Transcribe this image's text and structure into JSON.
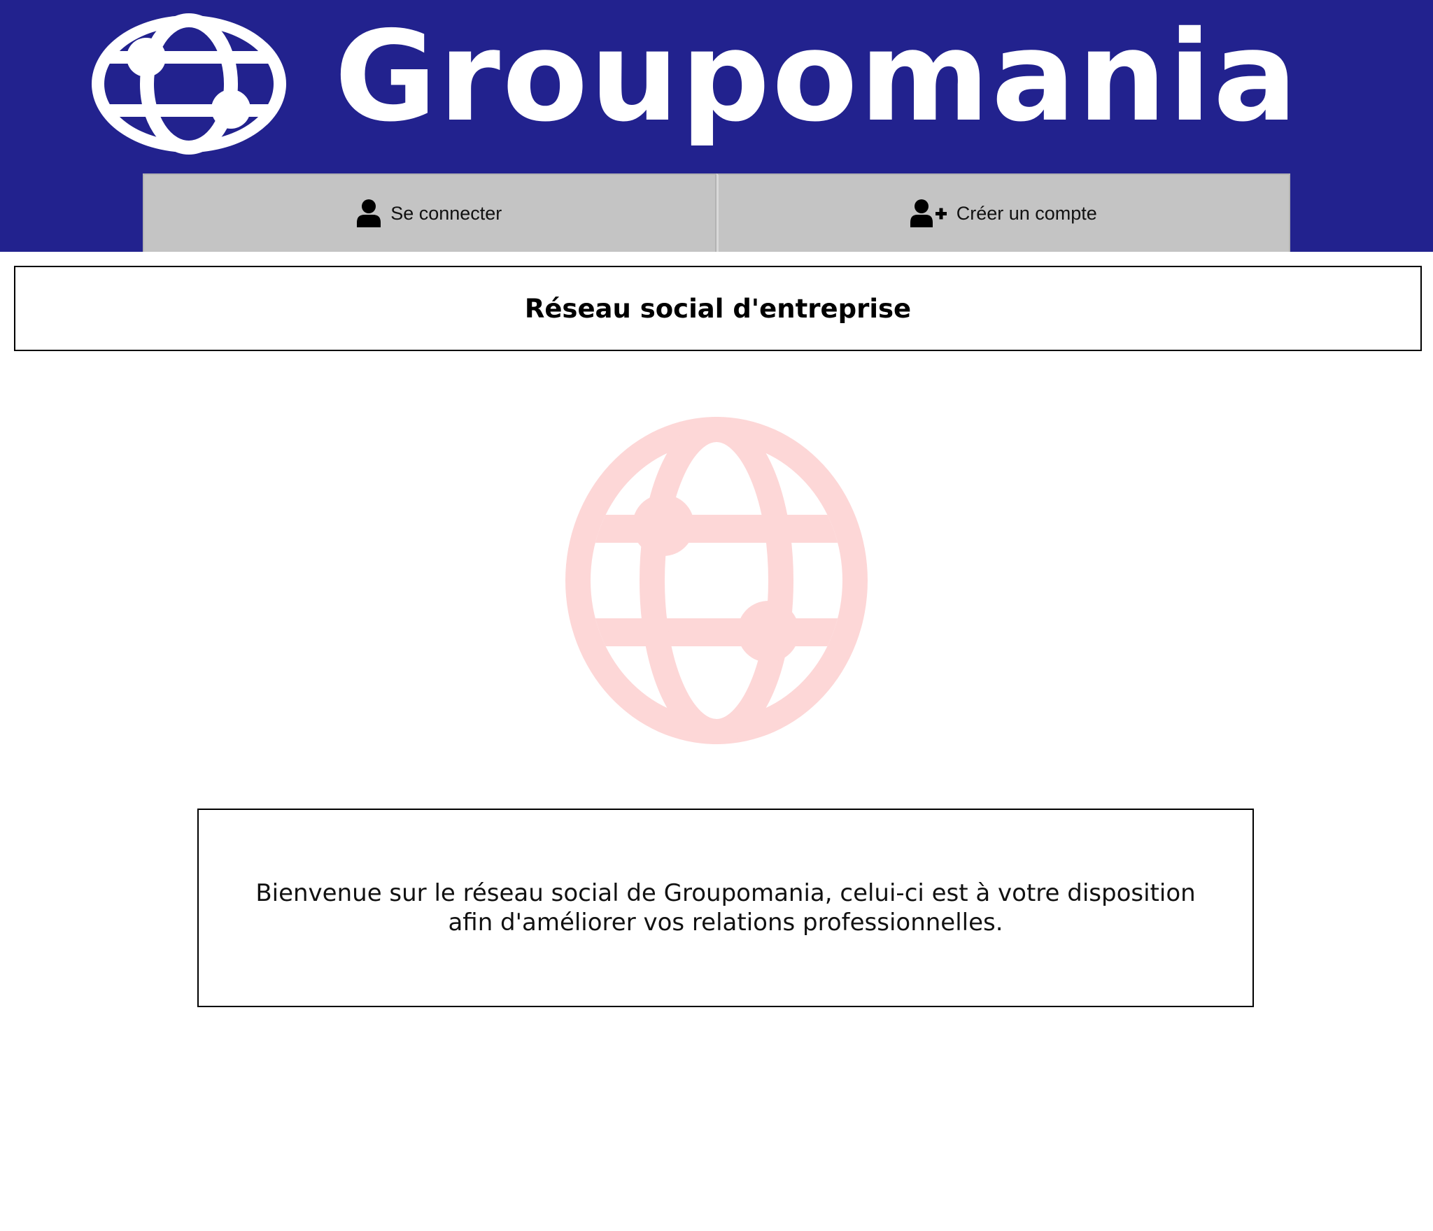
{
  "header": {
    "brand": "Groupomania",
    "background_color": "#22228e",
    "logo_icon": "globe-icon"
  },
  "nav": {
    "login": {
      "label": "Se connecter",
      "icon": "user-icon"
    },
    "signup": {
      "label": "Créer un compte",
      "icon": "user-plus-icon"
    },
    "button_color": "#c4c4c4"
  },
  "main": {
    "title": "Réseau social d'entreprise",
    "illustration_icon": "globe-icon",
    "illustration_color": "#fdd7d7",
    "welcome_text": "Bienvenue sur le réseau social de Groupomania, celui-ci est à votre disposition afin d'améliorer vos relations professionnelles."
  }
}
